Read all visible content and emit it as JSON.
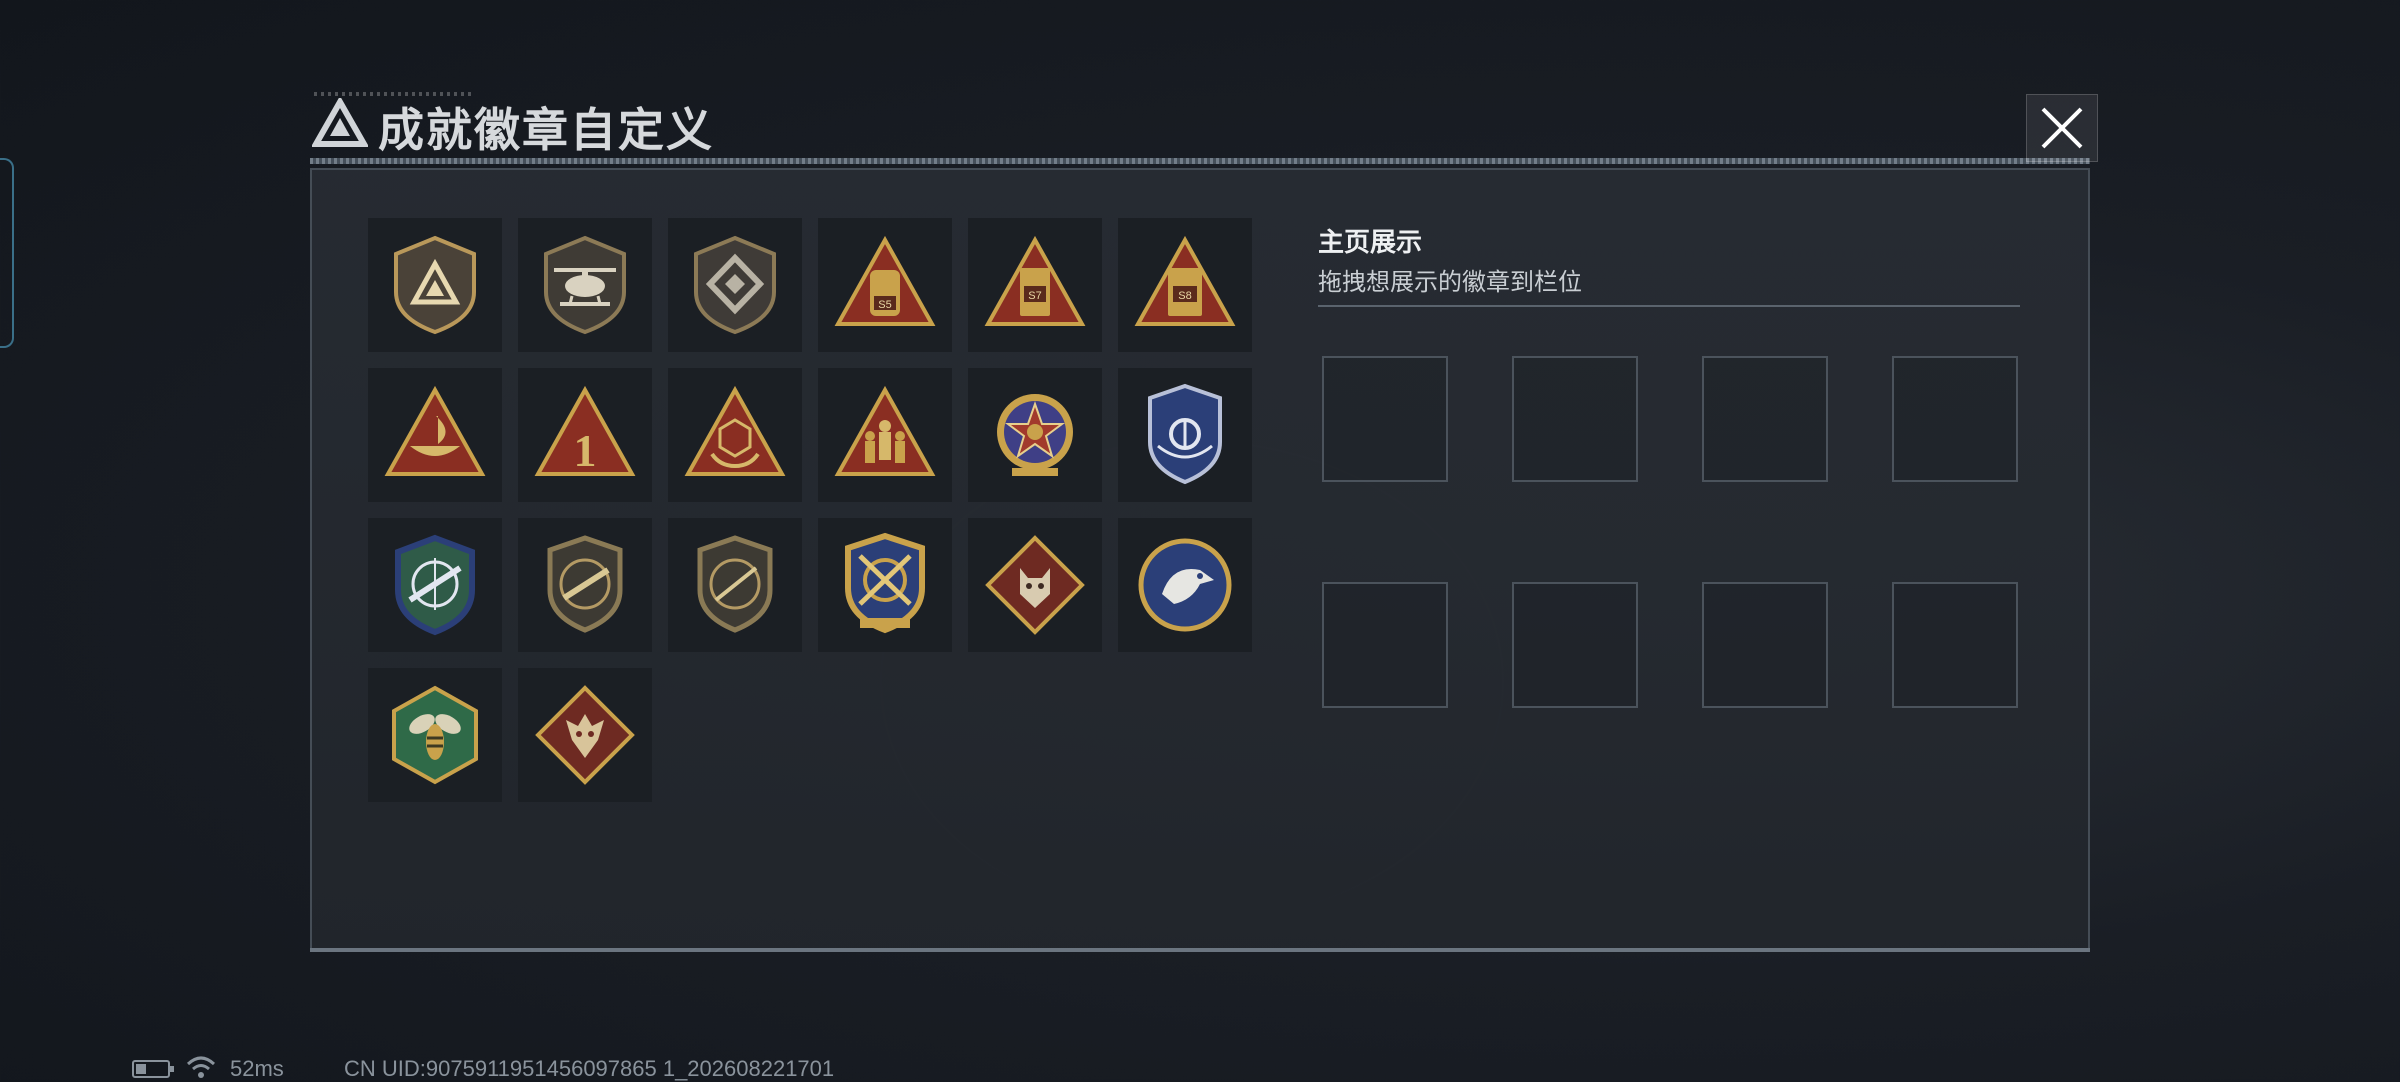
{
  "header": {
    "title": "成就徽章自定义",
    "close_icon": "close-x-icon"
  },
  "badges": [
    {
      "name": "triangle-logo-shield-badge",
      "label": ""
    },
    {
      "name": "helicopter-shield-badge",
      "label": ""
    },
    {
      "name": "diamond-emblem-shield-badge",
      "label": ""
    },
    {
      "name": "s5-tower-triangle-badge",
      "label": "S5"
    },
    {
      "name": "s7-tower-triangle-badge",
      "label": "S7"
    },
    {
      "name": "s8-tower-triangle-badge",
      "label": "S8"
    },
    {
      "name": "boat-triangle-badge",
      "label": ""
    },
    {
      "name": "number-one-triangle-badge",
      "label": "1"
    },
    {
      "name": "dice-triangle-badge",
      "label": ""
    },
    {
      "name": "soldiers-triangle-badge",
      "label": ""
    },
    {
      "name": "star-medal-badge",
      "label": ""
    },
    {
      "name": "blue-shield-eagle-badge",
      "label": ""
    },
    {
      "name": "rifle-crosshair-blue-shield-badge",
      "label": ""
    },
    {
      "name": "rifle-bronze-shield-badge",
      "label": ""
    },
    {
      "name": "sniper-bronze-shield-badge",
      "label": ""
    },
    {
      "name": "crossed-weapons-gold-shield-badge",
      "label": ""
    },
    {
      "name": "wolf-diamond-badge",
      "label": ""
    },
    {
      "name": "eagle-round-badge",
      "label": ""
    },
    {
      "name": "wasp-hexagon-badge",
      "label": ""
    },
    {
      "name": "dragon-diamond-badge",
      "label": ""
    }
  ],
  "showcase": {
    "title": "主页展示",
    "subtitle": "拖拽想展示的徽章到栏位",
    "slot_count": 8
  },
  "status": {
    "battery_icon": "battery-icon",
    "wifi_icon": "wifi-icon",
    "ping": "52ms",
    "uid": "CN UID:9075911951456097865 1_202608221701"
  },
  "colors": {
    "gold": "#c9a24b",
    "bronze": "#8a7a55",
    "red": "#8a2e22",
    "blue": "#2b3f78",
    "green": "#2f6a48"
  }
}
